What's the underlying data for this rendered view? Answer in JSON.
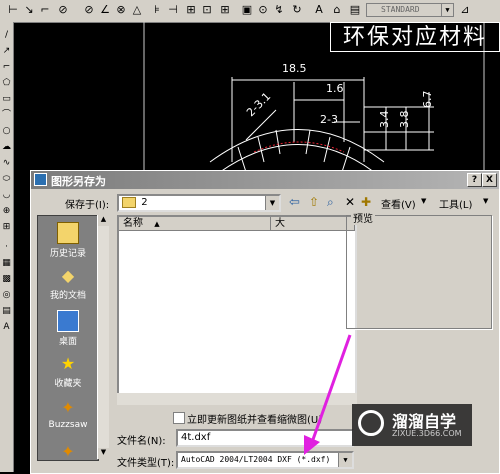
{
  "toolbar": {
    "style_value": "STANDARD",
    "icons": [
      "linear-dim-icon",
      "aligned-dim-icon",
      "ordinate-dim-icon",
      "radius-dim-icon",
      "diameter-dim-icon",
      "angular-dim-icon",
      "quick-dim-icon",
      "baseline-dim-icon",
      "continue-dim-icon",
      "tolerance-dim-icon",
      "center-mark-icon",
      "dim-edit-icon",
      "dim-text-edit-icon",
      "dim-update-icon",
      "dim-style-icon"
    ]
  },
  "drawing": {
    "title": "环保对应材料",
    "dims": [
      "18.5",
      "1.6",
      "2-3.1",
      "2-3",
      "3.4",
      "3.8",
      "6.7"
    ]
  },
  "dialog": {
    "title": "图形另存为",
    "help_btn": "?",
    "close_btn": "X",
    "save_in_label": "保存于(I):",
    "save_in_value": "2",
    "views_label": "查看(V)",
    "tools_label": "工具(L)",
    "places": [
      {
        "label": "历史记录",
        "icon": "history-icon"
      },
      {
        "label": "我的文档",
        "icon": "my-documents-icon"
      },
      {
        "label": "桌面",
        "icon": "desktop-icon"
      },
      {
        "label": "收藏夹",
        "icon": "favorites-icon"
      },
      {
        "label": "Buzzsaw",
        "icon": "buzzsaw-icon"
      }
    ],
    "columns": {
      "name": "名称",
      "size": "大"
    },
    "preview_label": "预览",
    "update_thumb_label": "立即更新图纸并查看缩微图(U)",
    "filename_label": "文件名(N):",
    "filename_value": "4t.dxf",
    "filetype_label": "文件类型(T):",
    "filetype_value": "AutoCAD 2004/LT2004 DXF (*.dxf)"
  },
  "watermark": {
    "title": "溜溜自学",
    "sub": "ZIXUE.3D66.COM"
  }
}
